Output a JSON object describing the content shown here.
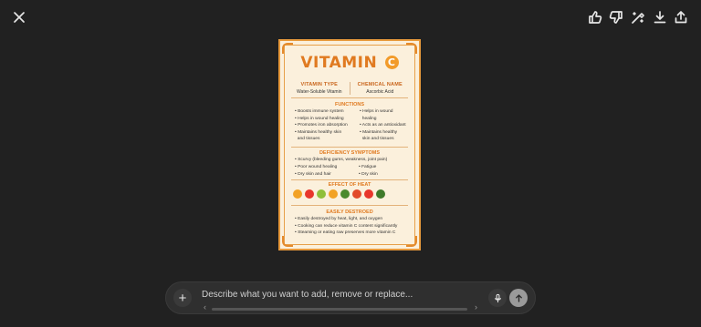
{
  "toolbar": {
    "close_icon": "close-icon",
    "actions": [
      "thumbs-up-icon",
      "thumbs-down-icon",
      "edit-image-icon",
      "download-icon",
      "share-icon"
    ]
  },
  "poster": {
    "title": "VITAMIN",
    "title_badge": "C",
    "vitamin_type_header": "VITAMIN TYPE",
    "vitamin_type_value": "Water-Soluble Vitamin",
    "chemical_name_header": "CHEMICAL NAME",
    "chemical_name_value": "Ascorbic Acid",
    "functions_header": "FUNCTIONS",
    "functions_left": [
      "• Boosts immune system",
      "• Helps in wound healing",
      "• Promotes iron absorption",
      "• Maintains healthy skin",
      "  and tissues"
    ],
    "functions_right": [
      "• Helps in wound",
      "  healing",
      "• Acts as an antioxidant",
      "• Maintains healthy",
      "  skin and tissues"
    ],
    "deficiency_header": "DEFICIENCY SYMPTOMS",
    "deficiency_line1": "• Scurvy (bleeding gums, weakness, joint pain)",
    "deficiency_left": [
      "• Poor wound healing",
      "• Dry skin and hair"
    ],
    "deficiency_right": [
      "• Fatigue",
      "• Dry skin"
    ],
    "heat_header": "EFFECT OF HEAT",
    "destroyed_header": "EASILY DESTROED",
    "destroyed_lines": [
      "• Easily destroyed by heat, light, and oxygen",
      "• Cooking can reduce vitamin C content significantly",
      "• Steaming or eating raw preserves more vitamin C"
    ],
    "fruit_colors": [
      "#f2a225",
      "#e8362b",
      "#8fbf3a",
      "#f2a225",
      "#4a8a2c",
      "#e24a2a",
      "#e8362b",
      "#3f7a2a"
    ]
  },
  "composer": {
    "placeholder": "Describe what you want to add, remove or replace...",
    "plus_label": "+"
  }
}
